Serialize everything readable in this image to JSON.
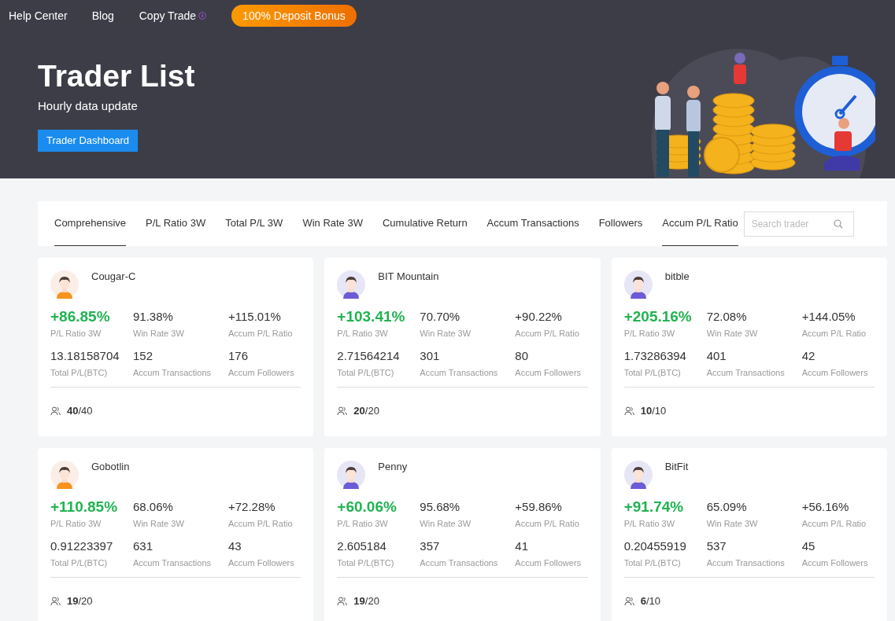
{
  "nav": {
    "links": [
      "Help Center",
      "Blog",
      "Copy Trade"
    ],
    "bonus_button": "100% Deposit Bonus"
  },
  "hero": {
    "title": "Trader List",
    "subtitle": "Hourly data update",
    "button": "Trader Dashboard"
  },
  "tabs": [
    {
      "label": "Comprehensive",
      "selected": true
    },
    {
      "label": "P/L Ratio 3W",
      "selected": false
    },
    {
      "label": "Total P/L 3W",
      "selected": false
    },
    {
      "label": "Win Rate 3W",
      "selected": false
    },
    {
      "label": "Cumulative Return",
      "selected": false
    },
    {
      "label": "Accum Transactions",
      "selected": false
    },
    {
      "label": "Followers",
      "selected": false
    },
    {
      "label": "Accum P/L Ratio",
      "selected": true
    }
  ],
  "search": {
    "placeholder": "Search trader"
  },
  "traders": [
    {
      "name": "Cougar-C",
      "kind": "orange",
      "stats": [
        {
          "value": "+86.85%",
          "label": "P/L Ratio 3W"
        },
        {
          "value": "91.38%",
          "label": "Win Rate 3W"
        },
        {
          "value": "+115.01%",
          "label": "Accum P/L Ratio"
        },
        {
          "value": "13.18158704",
          "label": "Total P/L(BTC)"
        },
        {
          "value": "152",
          "label": "Accum Transactions"
        },
        {
          "value": "176",
          "label": "Accum Followers"
        }
      ],
      "slots_used": "40",
      "slots_total": "/40"
    },
    {
      "name": "BIT Mountain",
      "kind": "purple",
      "stats": [
        {
          "value": "+103.41%",
          "label": "P/L Ratio 3W"
        },
        {
          "value": "70.70%",
          "label": "Win Rate 3W"
        },
        {
          "value": "+90.22%",
          "label": "Accum P/L Ratio"
        },
        {
          "value": "2.71564214",
          "label": "Total P/L(BTC)"
        },
        {
          "value": "301",
          "label": "Accum Transactions"
        },
        {
          "value": "80",
          "label": "Accum Followers"
        }
      ],
      "slots_used": "20",
      "slots_total": "/20"
    },
    {
      "name": "bitble",
      "kind": "purple",
      "stats": [
        {
          "value": "+205.16%",
          "label": "P/L Ratio 3W"
        },
        {
          "value": "72.08%",
          "label": "Win Rate 3W"
        },
        {
          "value": "+144.05%",
          "label": "Accum P/L Ratio"
        },
        {
          "value": "1.73286394",
          "label": "Total P/L(BTC)"
        },
        {
          "value": "401",
          "label": "Accum Transactions"
        },
        {
          "value": "42",
          "label": "Accum Followers"
        }
      ],
      "slots_used": "10",
      "slots_total": "/10"
    },
    {
      "name": "Gobotlin",
      "kind": "orange",
      "stats": [
        {
          "value": "+110.85%",
          "label": "P/L Ratio 3W"
        },
        {
          "value": "68.06%",
          "label": "Win Rate 3W"
        },
        {
          "value": "+72.28%",
          "label": "Accum P/L Ratio"
        },
        {
          "value": "0.91223397",
          "label": "Total P/L(BTC)"
        },
        {
          "value": "631",
          "label": "Accum Transactions"
        },
        {
          "value": "43",
          "label": "Accum Followers"
        }
      ],
      "slots_used": "19",
      "slots_total": "/20"
    },
    {
      "name": "Penny",
      "kind": "purple",
      "stats": [
        {
          "value": "+60.06%",
          "label": "P/L Ratio 3W"
        },
        {
          "value": "95.68%",
          "label": "Win Rate 3W"
        },
        {
          "value": "+59.86%",
          "label": "Accum P/L Ratio"
        },
        {
          "value": "2.605184",
          "label": "Total P/L(BTC)"
        },
        {
          "value": "357",
          "label": "Accum Transactions"
        },
        {
          "value": "41",
          "label": "Accum Followers"
        }
      ],
      "slots_used": "19",
      "slots_total": "/20"
    },
    {
      "name": "BitFit",
      "kind": "purple",
      "stats": [
        {
          "value": "+91.74%",
          "label": "P/L Ratio 3W"
        },
        {
          "value": "65.09%",
          "label": "Win Rate 3W"
        },
        {
          "value": "+56.16%",
          "label": "Accum P/L Ratio"
        },
        {
          "value": "0.20455919",
          "label": "Total P/L(BTC)"
        },
        {
          "value": "537",
          "label": "Accum Transactions"
        },
        {
          "value": "45",
          "label": "Accum Followers"
        }
      ],
      "slots_used": "6",
      "slots_total": "/10"
    }
  ]
}
